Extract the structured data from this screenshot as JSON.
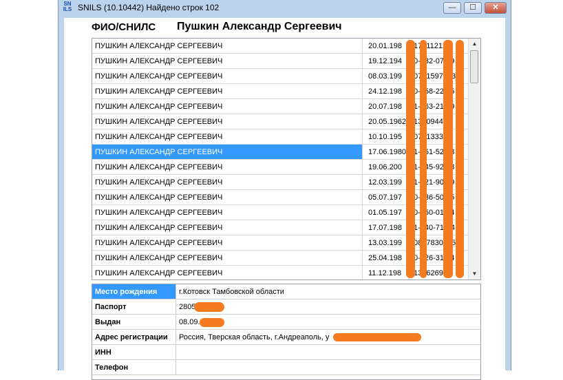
{
  "window": {
    "title": "SNILS (10.10442) Найдено строк 102",
    "app_icon_text": "SN ILS",
    "buttons": {
      "minimize": "—",
      "maximize": "☐",
      "close": "✕"
    }
  },
  "search": {
    "label": "ФИО/СНИЛС",
    "value": "Пушкин Александр Сергеевич"
  },
  "results": {
    "selected_index": 7,
    "rows": [
      {
        "name": "ПУШКИН АЛЕКСАНДР СЕРГЕЕВИЧ",
        "date": "20.01.198",
        "snils": "170112121"
      },
      {
        "name": "ПУШКИН АЛЕКСАНДР СЕРГЕЕВИЧ",
        "date": "19.12.194",
        "snils": "0-682-07 49"
      },
      {
        "name": "ПУШКИН АЛЕКСАНДР СЕРГЕЕВИЧ",
        "date": "08.03.199",
        "snils": "0721597733"
      },
      {
        "name": "ПУШКИН АЛЕКСАНДР СЕРГЕЕВИЧ",
        "date": "24.12.198",
        "snils": "0-058-22 55"
      },
      {
        "name": "ПУШКИН АЛЕКСАНДР СЕРГЕЕВИЧ",
        "date": "20.07.198",
        "snils": "1-863-21 89"
      },
      {
        "name": "ПУШКИН АЛЕКСАНДР СЕРГЕЕВИЧ",
        "date": "20.05.1962",
        "snils": "133094437"
      },
      {
        "name": "ПУШКИН АЛЕКСАНДР СЕРГЕЕВИЧ",
        "date": "10.10.195",
        "snils": "07313332"
      },
      {
        "name": "ПУШКИН АЛЕКСАНДР СЕРГЕЕВИЧ",
        "date": "17.06.1980",
        "snils": "1-551-52 58"
      },
      {
        "name": "ПУШКИН АЛЕКСАНДР СЕРГЕЕВИЧ",
        "date": "19.06.200",
        "snils": "1-545-92 08"
      },
      {
        "name": "ПУШКИН АЛЕКСАНДР СЕРГЕЕВИЧ",
        "date": "12.03.199",
        "snils": "1-621-90 89"
      },
      {
        "name": "ПУШКИН АЛЕКСАНДР СЕРГЕЕВИЧ",
        "date": "05.07.197",
        "snils": "0-736-50 75"
      },
      {
        "name": "ПУШКИН АЛЕКСАНДР СЕРГЕЕВИЧ",
        "date": "01.05.197",
        "snils": "0-550-01 04"
      },
      {
        "name": "ПУШКИН АЛЕКСАНДР СЕРГЕЕВИЧ",
        "date": "17.07.198",
        "snils": "1-540-71-34"
      },
      {
        "name": "ПУШКИН АЛЕКСАНДР СЕРГЕЕВИЧ",
        "date": "13.03.199",
        "snils": "0837830065"
      },
      {
        "name": "ПУШКИН АЛЕКСАНДР СЕРГЕЕВИЧ",
        "date": "25.04.198",
        "snils": "0-726-31 94"
      },
      {
        "name": "ПУШКИН АЛЕКСАНДР СЕРГЕЕВИЧ",
        "date": "11.12.198",
        "snils": "13762692"
      }
    ]
  },
  "details": {
    "birthplace_label": "Место рождения",
    "birthplace_value": "г.Котовск Тамбовской области",
    "passport_label": "Паспорт",
    "passport_value": "2805",
    "issued_label": "Выдан",
    "issued_value": "08.09.",
    "address_label": "Адрес регистрации",
    "address_value": "Россия, Тверская область, г.Андреаполь, у",
    "inn_label": "ИНН",
    "inn_value": "",
    "phone_label": "Телефон",
    "phone_value": ""
  },
  "colors": {
    "selection": "#3399ff",
    "redaction": "#f47b20",
    "frame": "#bcd3ec"
  }
}
